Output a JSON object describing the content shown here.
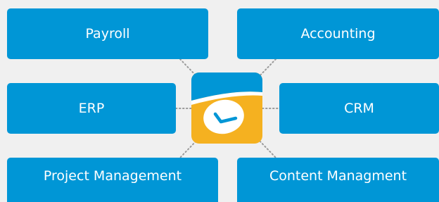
{
  "diagram": {
    "center": {
      "icon": "clock-app-icon",
      "colors": {
        "top": "#0096d6",
        "face": "#ffffff",
        "bottom": "#f5b120",
        "hands": "#0096d6"
      }
    },
    "modules": {
      "payroll": "Payroll",
      "accounting": "Accounting",
      "erp": "ERP",
      "crm": "CRM",
      "project_management": "Project Management",
      "content_management": "Content Managment"
    },
    "colors": {
      "box": "#0096d6",
      "box_text": "#ffffff",
      "background": "#f0f0f0",
      "connector": "#9a9a9a"
    }
  }
}
